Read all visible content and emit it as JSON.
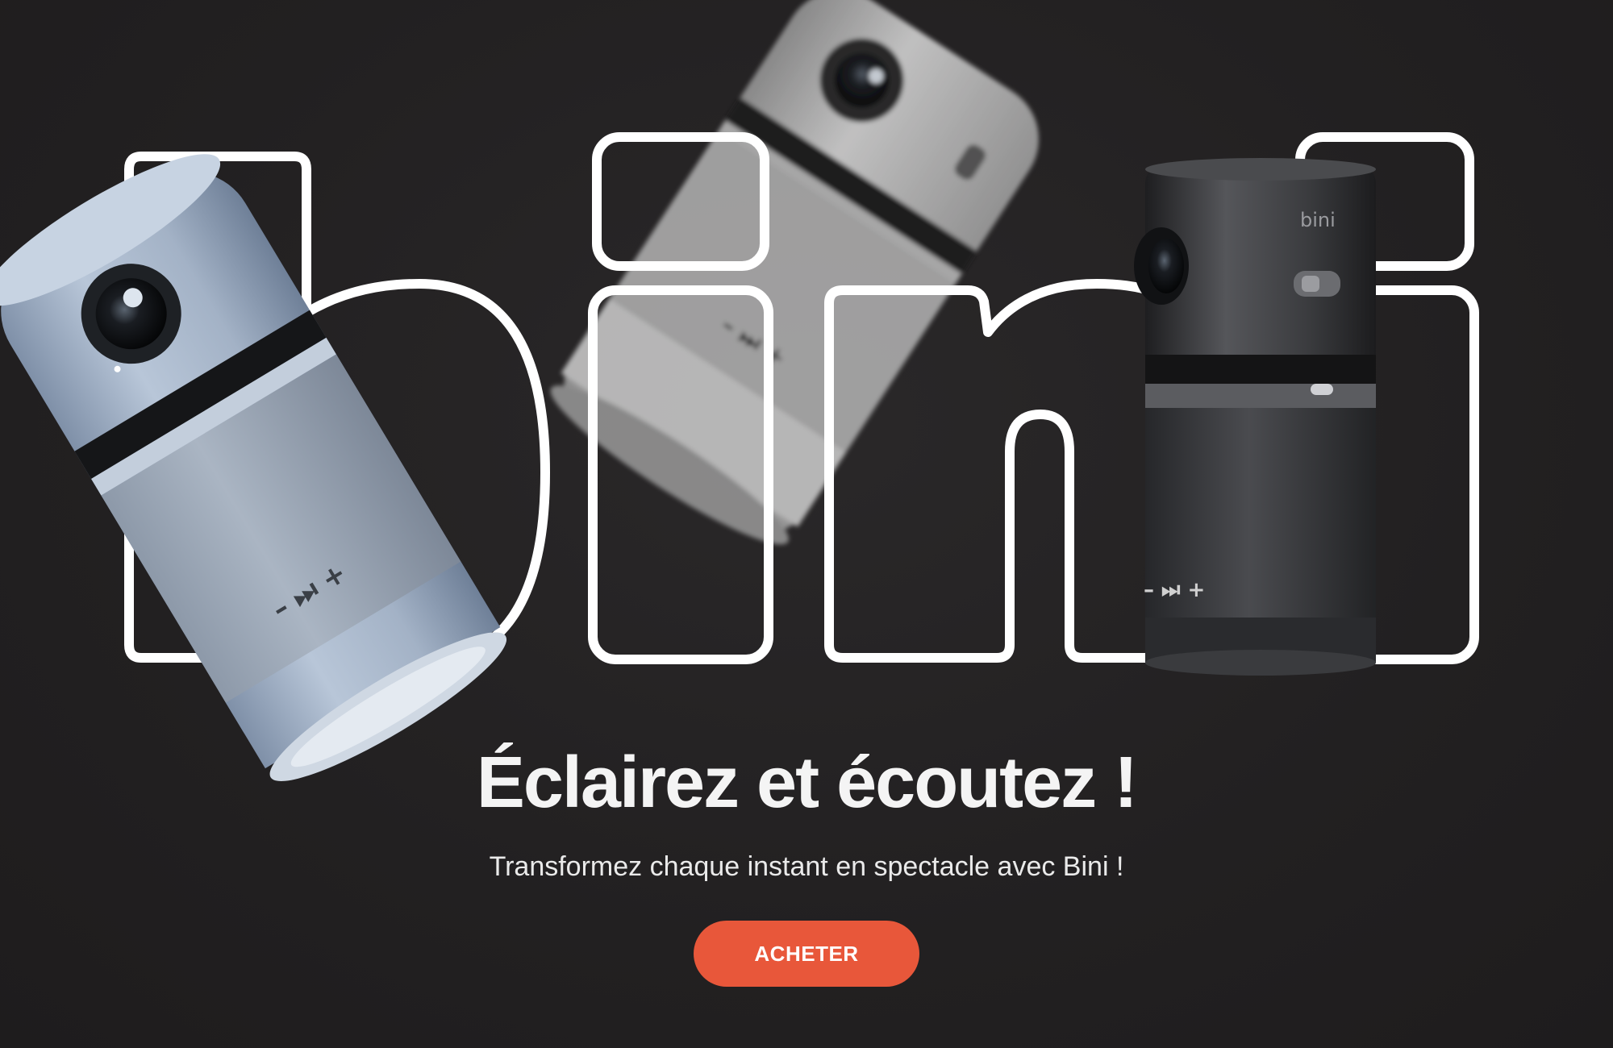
{
  "colors": {
    "background": "#232122",
    "outline": "#ffffff",
    "accent": "#e8573a",
    "device_blue": "#a8b7cc",
    "device_white": "#d6d6d6",
    "device_black": "#3a3a3c"
  },
  "hero": {
    "wordmark": "bini",
    "headline": "Éclairez et écoutez !",
    "subtitle": "Transformez chaque instant en spectacle avec Bini !",
    "cta_label": "ACHETER"
  },
  "devices": [
    {
      "name": "blue-projector",
      "color": "blue",
      "button_marks": "– ⏭ +"
    },
    {
      "name": "white-projector",
      "color": "white",
      "button_marks": "– ⏭ +"
    },
    {
      "name": "black-projector",
      "color": "black",
      "logo": "bini",
      "button_marks": "– ⏭ +"
    }
  ]
}
